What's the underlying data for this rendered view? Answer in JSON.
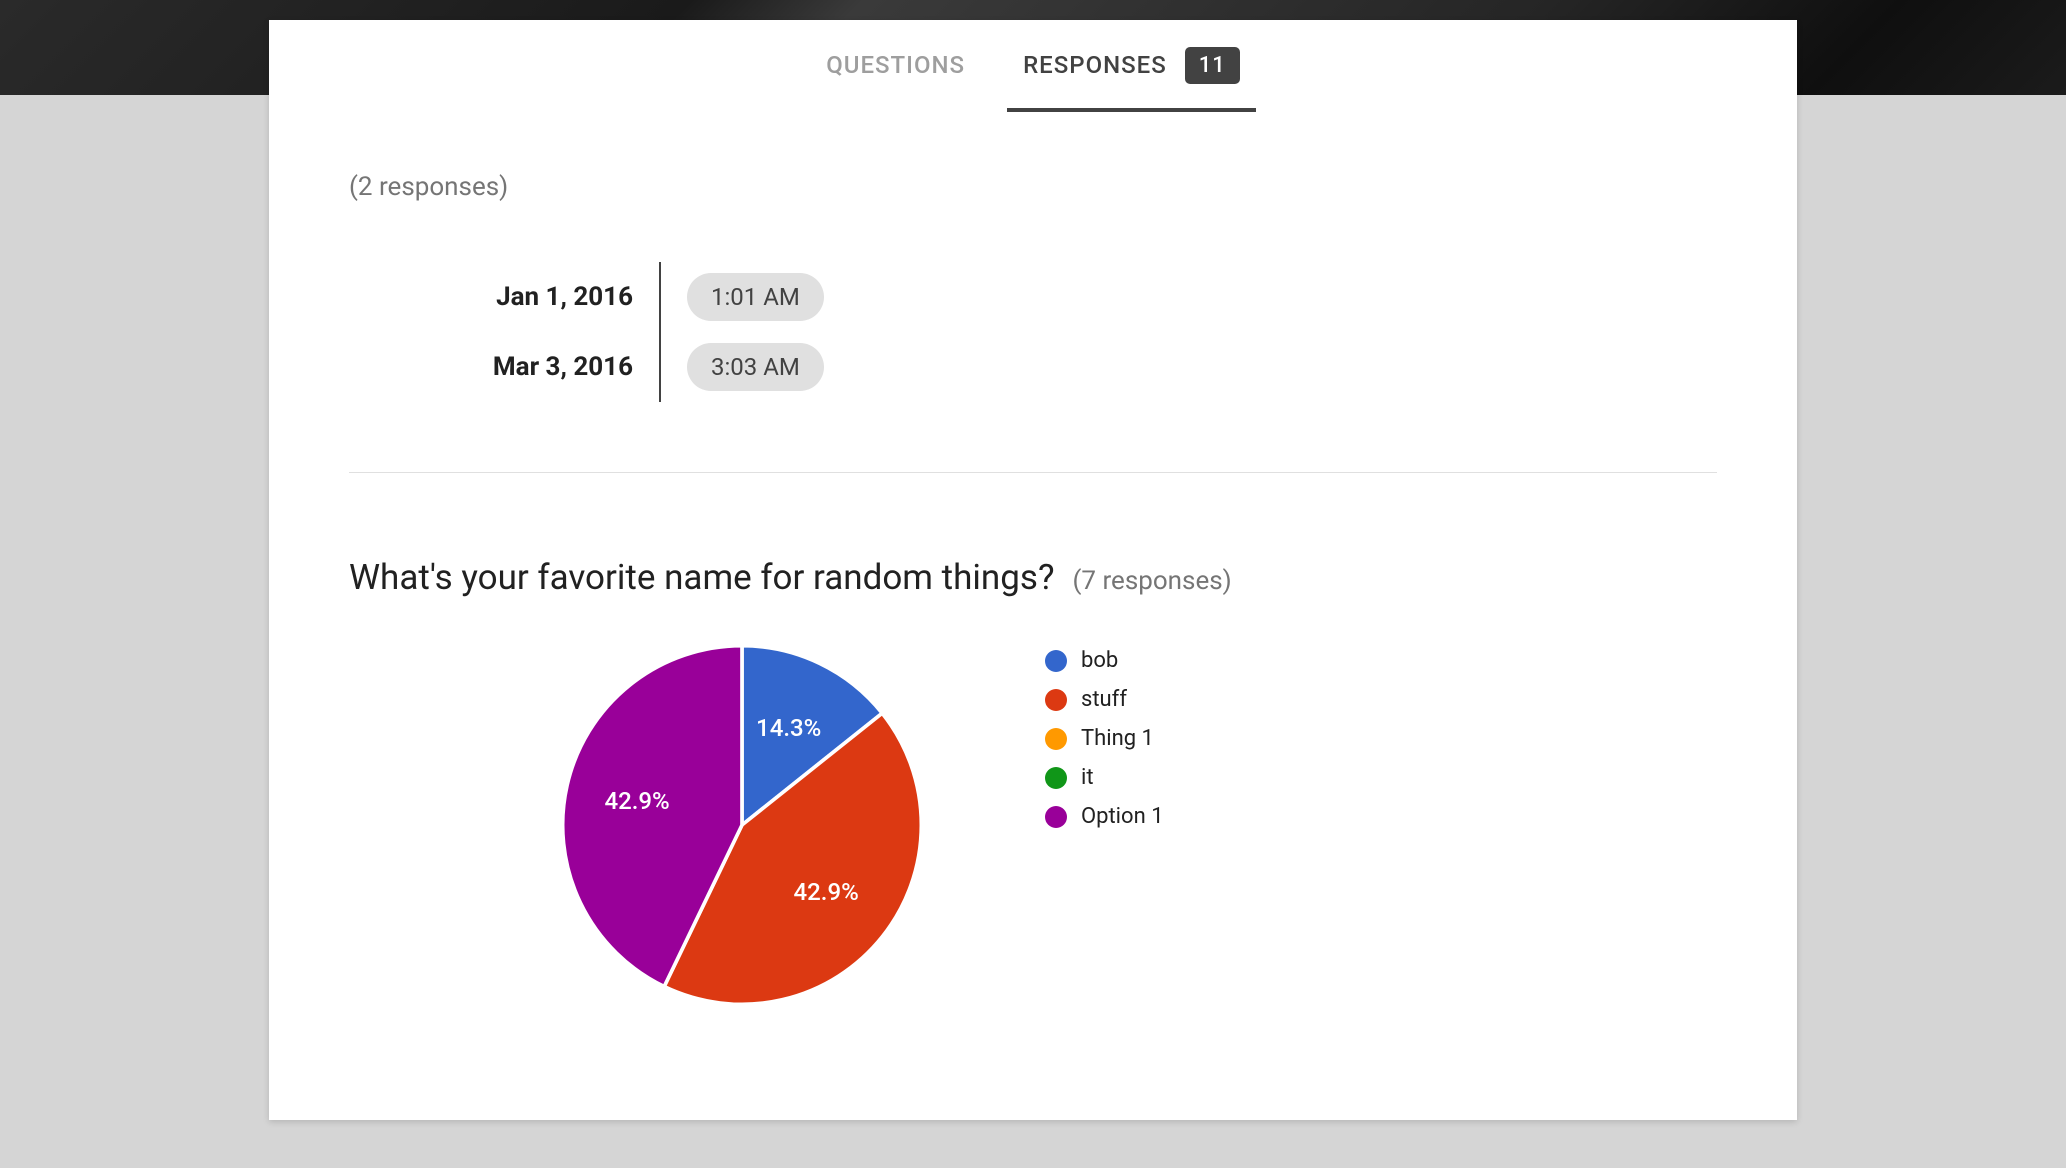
{
  "tabs": {
    "questions": "QUESTIONS",
    "responses": "RESPONSES",
    "badge": "11"
  },
  "topSection": {
    "countLabel": "(2 responses)",
    "rows": [
      {
        "date": "Jan 1, 2016",
        "time": "1:01 AM"
      },
      {
        "date": "Mar 3, 2016",
        "time": "3:03 AM"
      }
    ]
  },
  "question": {
    "title": "What's your favorite name for random things?",
    "countLabel": "(7 responses)"
  },
  "chart_data": {
    "type": "pie",
    "title": "What's your favorite name for random things?",
    "series": [
      {
        "name": "bob",
        "value": 14.3,
        "label": "14.3%",
        "color": "#3366cc"
      },
      {
        "name": "stuff",
        "value": 42.9,
        "label": "42.9%",
        "color": "#dc3912"
      },
      {
        "name": "Thing 1",
        "value": 0,
        "label": "",
        "color": "#ff9900"
      },
      {
        "name": "it",
        "value": 0,
        "label": "",
        "color": "#109618"
      },
      {
        "name": "Option 1",
        "value": 42.9,
        "label": "42.9%",
        "color": "#990099"
      }
    ],
    "legend_position": "right"
  }
}
